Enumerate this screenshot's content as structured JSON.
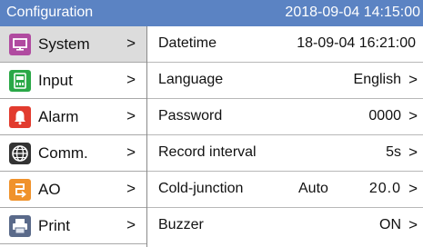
{
  "header": {
    "title": "Configuration",
    "datetime": "2018-09-04 14:15:00",
    "color": "#5b83c3"
  },
  "sidebar": {
    "items": [
      {
        "label": "System",
        "icon": "monitor-icon",
        "color": "#b04aa0",
        "selected": true
      },
      {
        "label": "Input",
        "icon": "input-card-icon",
        "color": "#2aa847"
      },
      {
        "label": "Alarm",
        "icon": "bell-icon",
        "color": "#e23b2e"
      },
      {
        "label": "Comm.",
        "icon": "globe-icon",
        "color": "#333333"
      },
      {
        "label": "AO",
        "icon": "output-icon",
        "color": "#f0922b"
      },
      {
        "label": "Print",
        "icon": "printer-icon",
        "color": "#5a6a8a"
      }
    ],
    "chevron": ">"
  },
  "settings": {
    "datetime": {
      "label": "Datetime",
      "value": "18-09-04 16:21:00"
    },
    "language": {
      "label": "Language",
      "value": "English"
    },
    "password": {
      "label": "Password",
      "value": "0000"
    },
    "record_interval": {
      "label": "Record interval",
      "value": "5s"
    },
    "cold_junction": {
      "label": "Cold-junction",
      "mode": "Auto",
      "value": "20.0"
    },
    "buzzer": {
      "label": "Buzzer",
      "value": "ON"
    },
    "chevron": ">"
  }
}
